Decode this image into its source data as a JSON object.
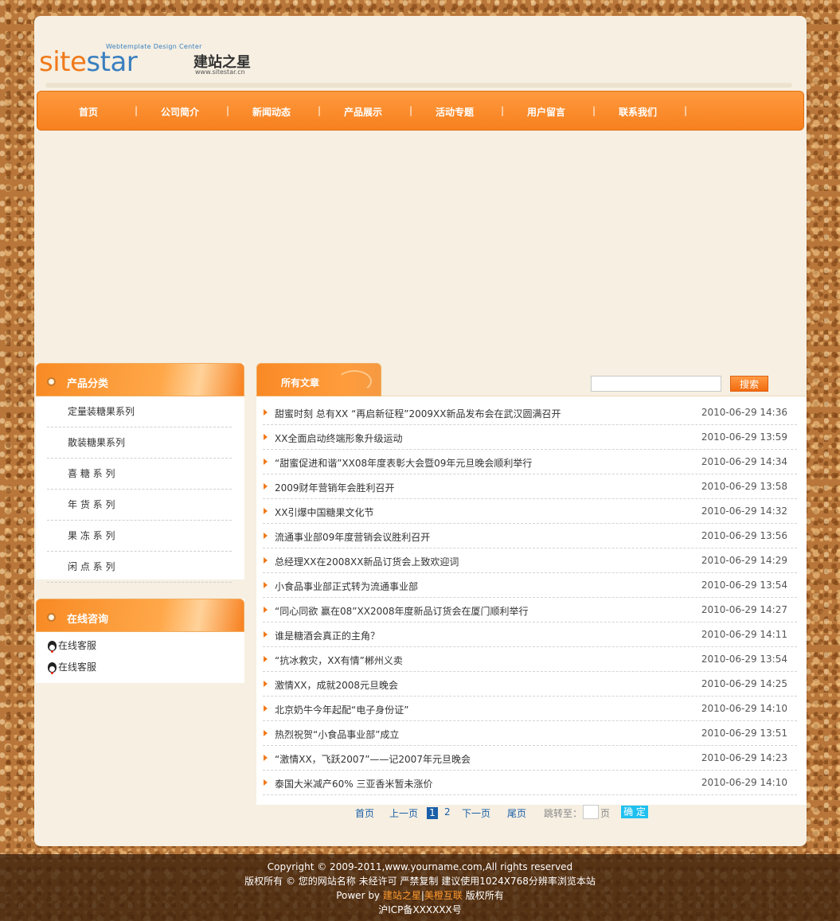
{
  "logo": {
    "tagline": "Webtemplate Design Center",
    "brand_a": "site",
    "brand_b": "star",
    "chinese": "建站之星",
    "url": "www.sitestar.cn"
  },
  "nav": {
    "items": [
      "首页",
      "公司简介",
      "新闻动态",
      "产品展示",
      "活动专题",
      "用户留言",
      "联系我们"
    ],
    "separator": "|"
  },
  "sidebar": {
    "categories": {
      "title": "产品分类",
      "items": [
        "定量装糖果系列",
        "散装糖果系列",
        "喜 糖 系 列",
        "年 货 系 列",
        "果 冻 系 列",
        "闲 点 系 列"
      ]
    },
    "consult": {
      "title": "在线咨询",
      "items": [
        "在线客服",
        "在线客服"
      ]
    }
  },
  "main": {
    "tab_title": "所有文章",
    "search_button": "搜索",
    "search_value": "",
    "articles": [
      {
        "title": "甜蜜时刻 总有XX “再启新征程”2009XX新品发布会在武汉圆满召开",
        "date": "2010-06-29 14:36"
      },
      {
        "title": "XX全面启动终端形象升级运动",
        "date": "2010-06-29 13:59"
      },
      {
        "title": "“甜蜜促进和谐”XX08年度表彰大会暨09年元旦晚会顺利举行",
        "date": "2010-06-29 14:34"
      },
      {
        "title": "2009财年营销年会胜利召开",
        "date": "2010-06-29 13:58"
      },
      {
        "title": "XX引爆中国糖果文化节",
        "date": "2010-06-29 14:32"
      },
      {
        "title": "流通事业部09年度营销会议胜利召开",
        "date": "2010-06-29 13:56"
      },
      {
        "title": "总经理XX在2008XX新品订货会上致欢迎词",
        "date": "2010-06-29 14:29"
      },
      {
        "title": "小食品事业部正式转为流通事业部",
        "date": "2010-06-29 13:54"
      },
      {
        "title": "“同心同欲 赢在08”XX2008年度新品订货会在厦门顺利举行",
        "date": "2010-06-29 14:27"
      },
      {
        "title": "谁是糖酒会真正的主角？",
        "date": "2010-06-29 14:11"
      },
      {
        "title": "“抗冰救灾，XX有情”郴州义卖",
        "date": "2010-06-29 13:54"
      },
      {
        "title": "激情XX，成就2008元旦晚会",
        "date": "2010-06-29 14:25"
      },
      {
        "title": "北京奶牛今年起配“电子身份证”",
        "date": "2010-06-29 14:10"
      },
      {
        "title": "热烈祝贺“小食品事业部”成立",
        "date": "2010-06-29 13:51"
      },
      {
        "title": "“激情XX，飞跃2007”——记2007年元旦晚会",
        "date": "2010-06-29 14:23"
      },
      {
        "title": "泰国大米减产60% 三亚香米暂未涨价",
        "date": "2010-06-29 14:10"
      }
    ]
  },
  "pager": {
    "first": "首页",
    "prev": "上一页",
    "pages": [
      "1",
      "2"
    ],
    "current_page": "1",
    "next": "下一页",
    "last": "尾页",
    "jump_label": "跳转至：",
    "page_unit": "页",
    "ok": "确 定"
  },
  "footer": {
    "copyright": "Copyright © 2009-2011,www.yourname.com,All rights reserved",
    "rights": "版权所有 © 您的网站名称 未经许可 严禁复制 建议使用1024X768分辨率浏览本站",
    "power_prefix": "Power by ",
    "power_link1": "建站之星",
    "power_sep": "|",
    "power_link2": "美橙互联",
    "power_suffix": " 版权所有",
    "icp": "沪ICP备XXXXXX号"
  },
  "colors": {
    "accent_orange": "#f7801e",
    "link_blue": "#1a5fa8",
    "page_bg": "#f6efe2"
  }
}
